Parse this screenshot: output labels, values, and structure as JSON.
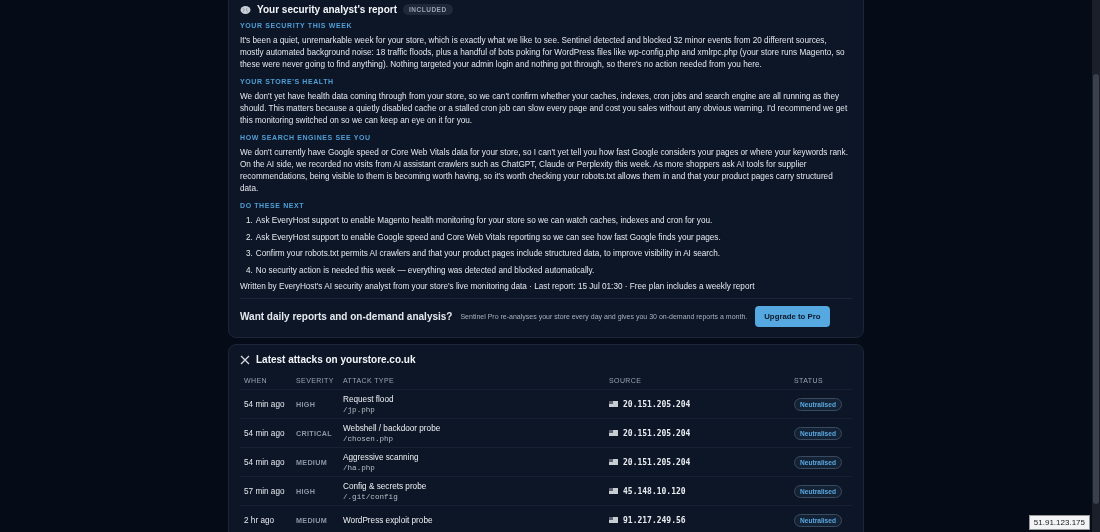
{
  "report": {
    "title": "Your security analyst's report",
    "badge": "INCLUDED",
    "sections": [
      {
        "heading": "YOUR SECURITY THIS WEEK",
        "text": "It's been a quiet, unremarkable week for your store, which is exactly what we like to see. Sentinel detected and blocked 32 minor events from 20 different sources, mostly automated background noise: 18 traffic floods, plus a handful of bots poking for WordPress files like wp-config.php and xmlrpc.php (your store runs Magento, so these were never going to find anything). Nothing targeted your admin login and nothing got through, so there's no action needed from you here."
      },
      {
        "heading": "YOUR STORE'S HEALTH",
        "text": "We don't yet have health data coming through from your store, so we can't confirm whether your caches, indexes, cron jobs and search engine are all running as they should. This matters because a quietly disabled cache or a stalled cron job can slow every page and cost you sales without any obvious warning. I'd recommend we get this monitoring switched on so we can keep an eye on it for you."
      },
      {
        "heading": "HOW SEARCH ENGINES SEE YOU",
        "text": "We don't currently have Google speed or Core Web Vitals data for your store, so I can't yet tell you how fast Google considers your pages or where your keywords rank. On the AI side, we recorded no visits from AI assistant crawlers such as ChatGPT, Claude or Perplexity this week. As more shoppers ask AI tools for supplier recommendations, being visible to them is becoming worth having, so it's worth checking your robots.txt allows them in and that your product pages carry structured data."
      }
    ],
    "todo_heading": "DO THESE NEXT",
    "todo": [
      {
        "number": "1.",
        "text": "Ask EveryHost support to enable Magento health monitoring for your store so we can watch caches, indexes and cron for you."
      },
      {
        "number": "2.",
        "text": "Ask EveryHost support to enable Google speed and Core Web Vitals reporting so we can see how fast Google finds your pages."
      },
      {
        "number": "3.",
        "text": "Confirm your robots.txt permits AI crawlers and that your product pages include structured data, to improve visibility in AI search."
      },
      {
        "number": "4.",
        "text": "No security action is needed this week — everything was detected and blocked automatically."
      }
    ],
    "footer": "Written by EveryHost's AI security analyst from your store's live monitoring data · Last report: 15 Jul 01:30 · Free plan includes a weekly report",
    "upsell": {
      "title": "Want daily reports and on-demand analysis?",
      "text": "Sentinel Pro re-analyses your store every day and gives you 30 on-demand reports a month.",
      "button": "Upgrade to Pro"
    }
  },
  "attacks": {
    "title": "Latest attacks on yourstore.co.uk",
    "columns": [
      "WHEN",
      "SEVERITY",
      "ATTACK TYPE",
      "SOURCE",
      "STATUS"
    ],
    "rows": [
      {
        "when": "54 min ago",
        "severity": "HIGH",
        "type": "Request flood",
        "path": "/jp.php",
        "source": "20.151.205.204",
        "status": "Neutralised"
      },
      {
        "when": "54 min ago",
        "severity": "CRITICAL",
        "type": "Webshell / backdoor probe",
        "path": "/chosen.php",
        "source": "20.151.205.204",
        "status": "Neutralised"
      },
      {
        "when": "54 min ago",
        "severity": "MEDIUM",
        "type": "Aggressive scanning",
        "path": "/ha.php",
        "source": "20.151.205.204",
        "status": "Neutralised"
      },
      {
        "when": "57 min ago",
        "severity": "HIGH",
        "type": "Config & secrets probe",
        "path": "/.git/config",
        "source": "45.148.10.120",
        "status": "Neutralised"
      },
      {
        "when": "2 hr ago",
        "severity": "MEDIUM",
        "type": "WordPress exploit probe",
        "source": "91.217.249.56",
        "status": "Neutralised"
      }
    ]
  },
  "ip_label": "51.91.123.175"
}
